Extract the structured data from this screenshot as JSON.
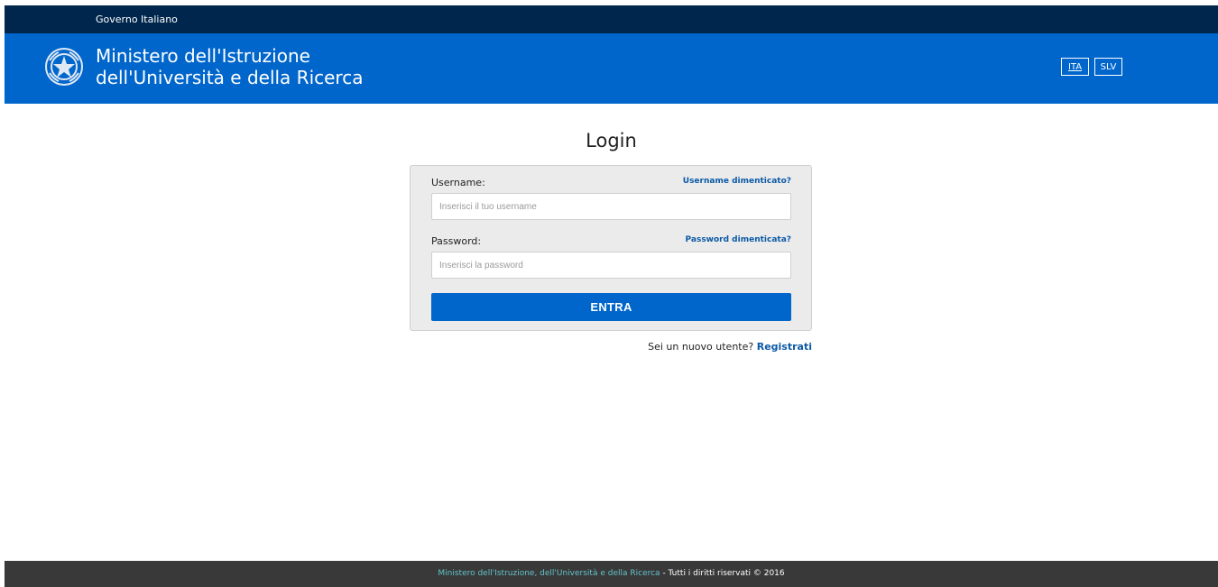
{
  "topbar": {
    "text": "Governo Italiano"
  },
  "header": {
    "ministry_line1": "Ministero dell'Istruzione",
    "ministry_line2": "dell'Università e della Ricerca",
    "lang_ita": "ITA",
    "lang_slv": "SLV",
    "emblem_icon": "republic-emblem-icon"
  },
  "login": {
    "title": "Login",
    "username_label": "Username:",
    "username_forgot": "Username dimenticato?",
    "username_placeholder": "Inserisci il tuo username",
    "password_label": "Password:",
    "password_forgot": "Password dimenticata?",
    "password_placeholder": "Inserisci la password",
    "submit_label": "ENTRA",
    "new_user_text": "Sei un nuovo utente?",
    "register_link": "Registrati"
  },
  "footer": {
    "ministry_link": "Ministero dell'Istruzione, dell'Università e della Ricerca",
    "rights": " - Tutti i diritti riservati © 2016"
  },
  "colors": {
    "topbar": "#00264d",
    "header": "#0066cc",
    "button": "#0066cc",
    "link": "#0c5aa6",
    "footer": "#393939",
    "footer_link": "#63c2c9"
  }
}
